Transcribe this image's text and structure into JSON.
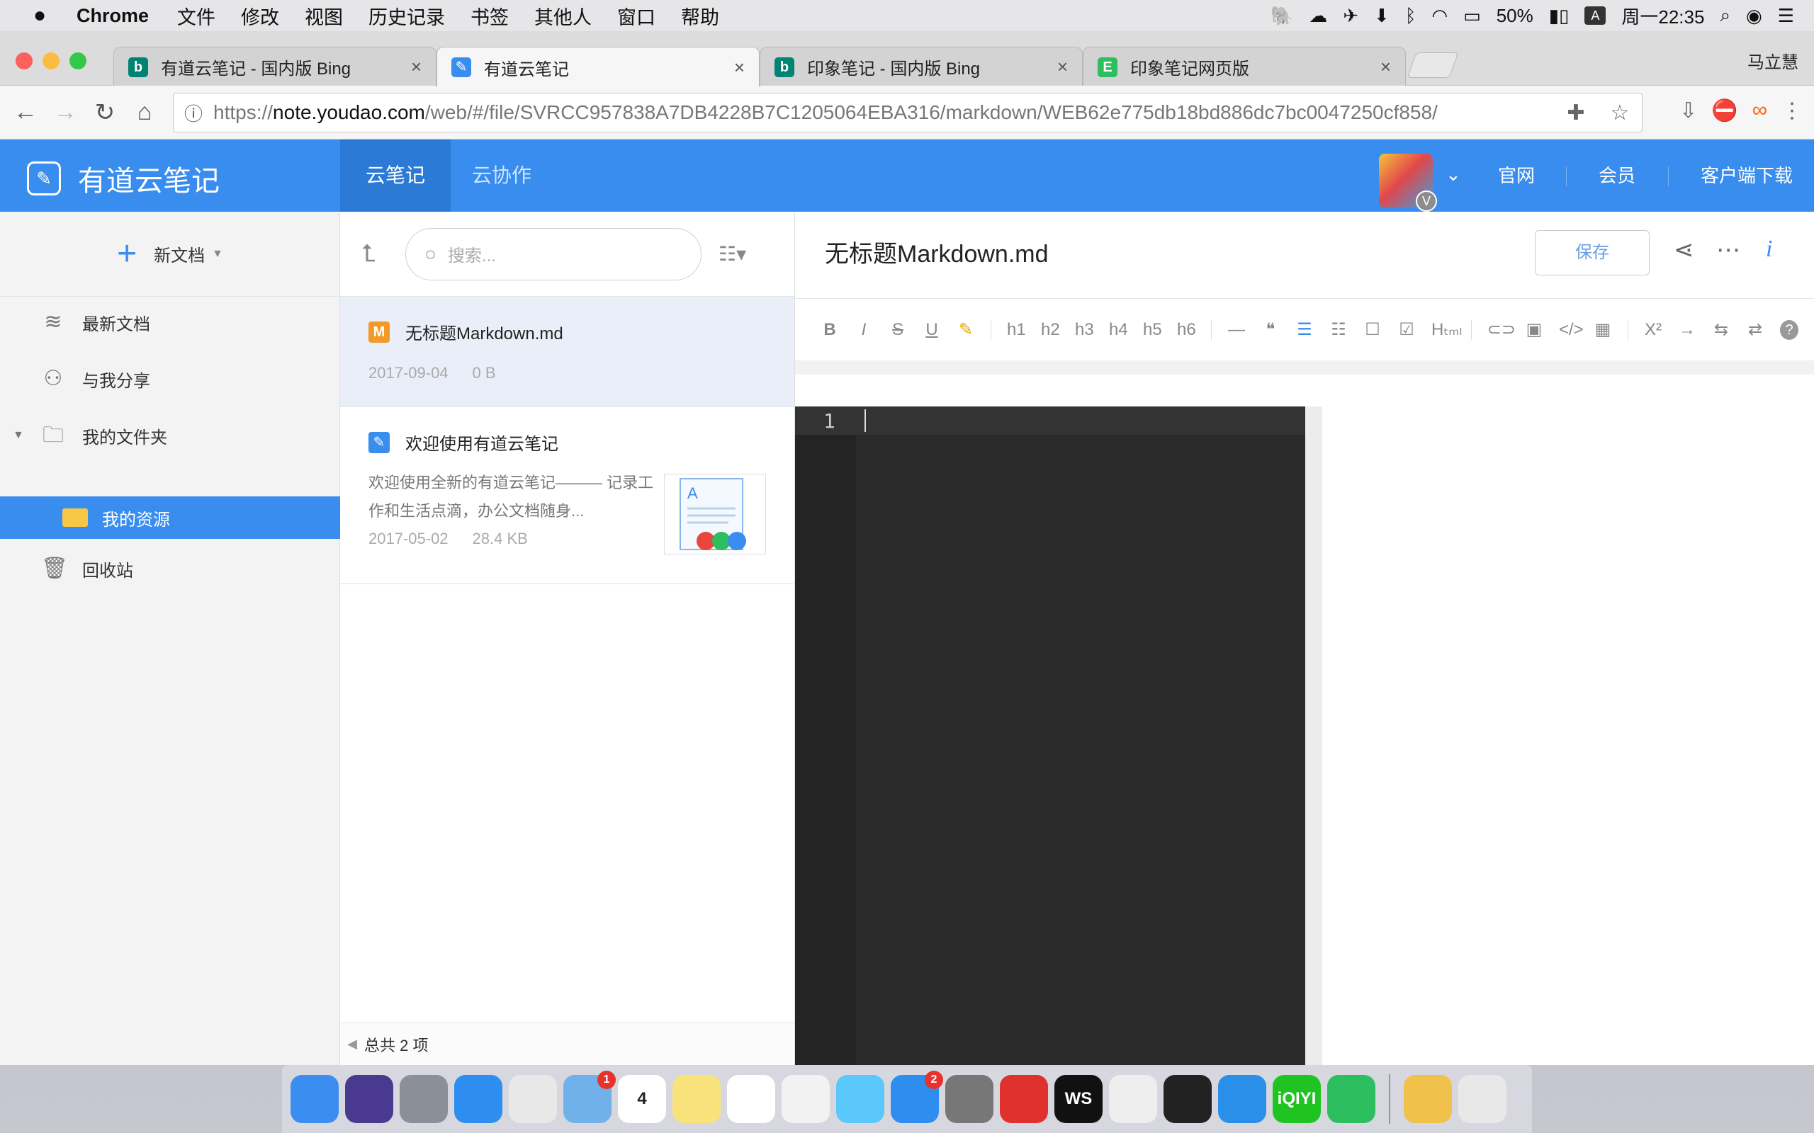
{
  "menubar": {
    "app": "Chrome",
    "menus": [
      "文件",
      "修改",
      "视图",
      "历史记录",
      "书签",
      "其他人",
      "窗口",
      "帮助"
    ],
    "battery": "50%",
    "input_method": "A",
    "clock": "周一22:35"
  },
  "browser": {
    "tabs": [
      {
        "label": "有道云笔记 - 国内版 Bing",
        "favicon": "bing-icon",
        "color": "#008373"
      },
      {
        "label": "有道云笔记",
        "favicon": "youdao-icon",
        "color": "#398dee"
      },
      {
        "label": "印象笔记 - 国内版 Bing",
        "favicon": "bing-icon",
        "color": "#008373"
      },
      {
        "label": "印象笔记网页版",
        "favicon": "evernote-icon",
        "color": "#2dbe60"
      }
    ],
    "profile": "马立慧",
    "url_prefix": "https://",
    "url_host": "note.youdao.com",
    "url_path": "/web/#/file/SVRCC957838A7DB4228B7C1205064EBA316/markdown/WEB62e775db18bd886dc7bc0047250cf858/"
  },
  "app": {
    "name": "有道云笔记",
    "tabs": [
      "云笔记",
      "云协作"
    ],
    "links": [
      "官网",
      "会员",
      "客户端下载"
    ],
    "avatar_badge": "V"
  },
  "sidebar": {
    "new_doc": "新文档",
    "items": [
      {
        "label": "最新文档",
        "icon": "layers-icon"
      },
      {
        "label": "与我分享",
        "icon": "share-user-icon"
      },
      {
        "label": "我的文件夹",
        "icon": "folder-icon"
      },
      {
        "label": "我的资源",
        "icon": "folder-icon"
      },
      {
        "label": "回收站",
        "icon": "trash-icon"
      }
    ]
  },
  "list": {
    "search_placeholder": "搜索...",
    "notes": [
      {
        "title": "无标题Markdown.md",
        "date": "2017-09-04",
        "size": "0 B",
        "icon": "M"
      },
      {
        "title": "欢迎使用有道云笔记",
        "summary": "欢迎使用全新的有道云笔记——— 记录工作和生活点滴，办公文档随身...",
        "date": "2017-05-02",
        "size": "28.4 KB"
      }
    ],
    "footer": "总共 2 项"
  },
  "editor": {
    "title": "无标题Markdown.md",
    "save": "保存",
    "toolbar": [
      "B",
      "I",
      "S",
      "U",
      "✎",
      "h1",
      "h2",
      "h3",
      "h4",
      "h5",
      "h6",
      "—",
      "❝",
      "☰",
      "☷",
      "☐",
      "☑",
      "Hₜₘₗ",
      "⊂⊃",
      "▣",
      "</>",
      "▦",
      "X²",
      "→",
      "⇆",
      "⇄",
      "?"
    ],
    "line_number": "1"
  },
  "dock": [
    {
      "name": "finder",
      "color": "#3b8df0"
    },
    {
      "name": "siri",
      "color": "#4a3a8f"
    },
    {
      "name": "launchpad",
      "color": "#8a8f98"
    },
    {
      "name": "safari",
      "color": "#2d8ef0"
    },
    {
      "name": "chrome",
      "color": "#e8e8e8"
    },
    {
      "name": "mail",
      "color": "#6fb1e8",
      "badge": "1"
    },
    {
      "name": "calendar",
      "color": "#ffffff",
      "text": "4"
    },
    {
      "name": "notes",
      "color": "#f8e27a"
    },
    {
      "name": "reminders",
      "color": "#ffffff"
    },
    {
      "name": "photos",
      "color": "#f2f2f2"
    },
    {
      "name": "messages",
      "color": "#5ac8fa"
    },
    {
      "name": "app-store",
      "color": "#2d8ef0",
      "badge": "2"
    },
    {
      "name": "system-preferences",
      "color": "#777"
    },
    {
      "name": "netease-music",
      "color": "#e0312f"
    },
    {
      "name": "webstorm",
      "color": "#111",
      "text": "WS"
    },
    {
      "name": "wechat",
      "color": "#eeeeee"
    },
    {
      "name": "terminal",
      "color": "#222"
    },
    {
      "name": "video-player",
      "color": "#2a8fe8"
    },
    {
      "name": "iqiyi",
      "color": "#1fc422",
      "text": "iQIYI"
    },
    {
      "name": "evernote",
      "color": "#2dbe60"
    },
    {
      "name": "qq",
      "color": "#f0c24b"
    },
    {
      "name": "trash",
      "color": "#e8e8e8"
    }
  ]
}
